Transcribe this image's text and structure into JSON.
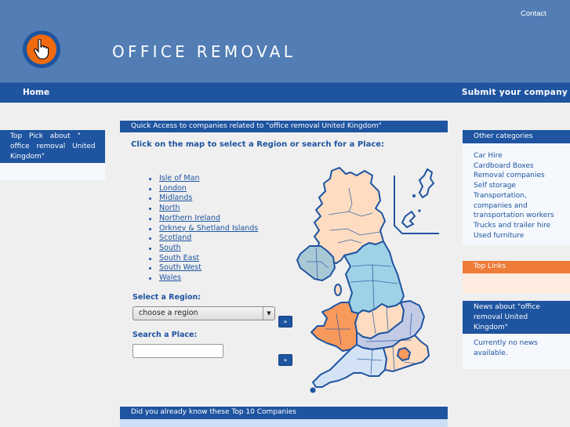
{
  "header": {
    "site_title": "OFFICE REMOVAL",
    "contact_label": "Contact",
    "logo_icon": "hand-pointer-icon"
  },
  "nav": {
    "home_label": "Home",
    "submit_label": "Submit your company"
  },
  "left_sidebar": {
    "top_pick_title": "Top Pick about \"  office removal  United Kingdom\""
  },
  "main": {
    "quick_access_title": "Quick Access to companies related to \"office removal United Kingdom\"",
    "map_instruction": "Click on the map to select a Region or search for a Place:",
    "regions": [
      "Isle of Man",
      "London",
      "Midlands",
      "North",
      "Northern Ireland",
      "Orkney & Shetland Islands",
      "Scotland",
      "South",
      "South East",
      "South West",
      "Wales"
    ],
    "select_region_label": "Select a Region:",
    "select_region_value": "choose a region",
    "search_place_label": "Search a Place:",
    "search_place_value": "",
    "go_button_label": "»",
    "top10_title": "Did you already know these Top 10 Companies",
    "map_colors": {
      "scotland": "#fddcc2",
      "north": "#9fd2e6",
      "northern_ireland": "#a9c8d6",
      "wales": "#f99a5d",
      "midlands": "#fddcc2",
      "east": "#c2cae6",
      "south_west": "#d3e3f5",
      "south_east": "#fddcc2",
      "london": "#f99a5d",
      "border": "#1e54a0"
    }
  },
  "right_sidebar": {
    "other_categories_title": "Other categories",
    "categories": [
      "Car Hire",
      "Cardboard Boxes",
      "Removal companies",
      "Self storage",
      "Transportation, companies and transportation workers",
      "Trucks and trailer hire",
      "Used furniture"
    ],
    "top_links_title": "Top Links",
    "news_title": "News about \"office removal United Kingdom\"",
    "news_body": "Currently no news available."
  },
  "colors": {
    "header_bg": "#527db5",
    "nav_bg": "#1e54a0",
    "accent_orange": "#ef7b38",
    "link_blue": "#1e54a0"
  }
}
